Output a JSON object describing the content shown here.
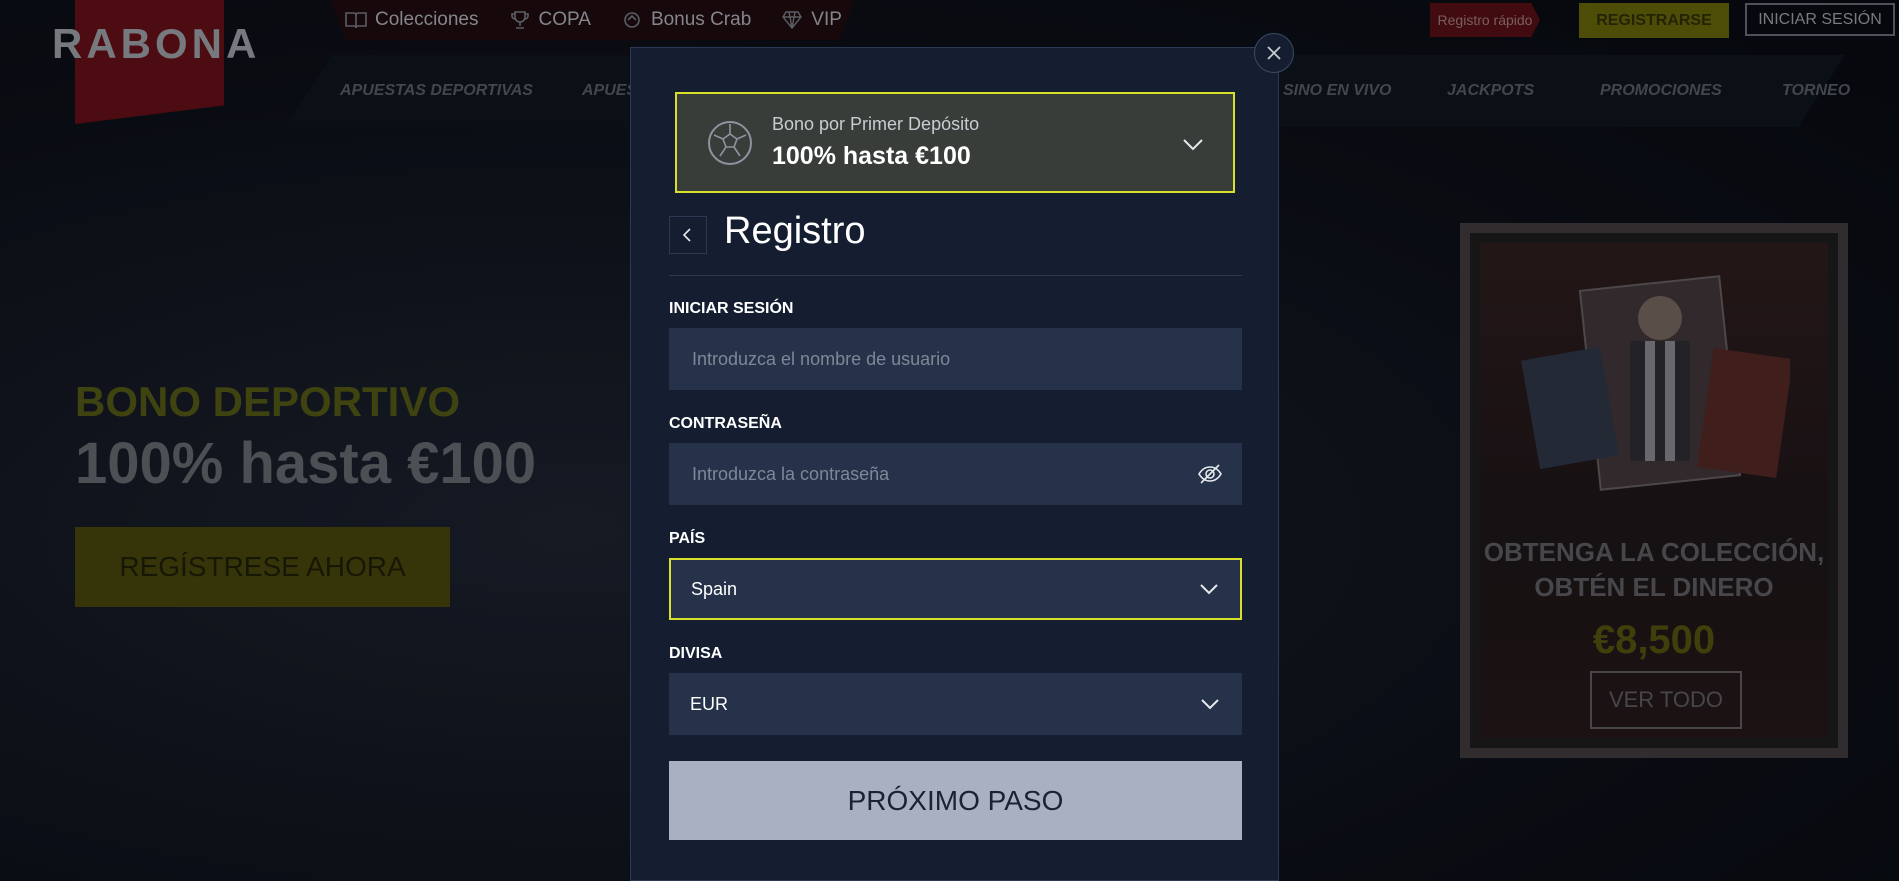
{
  "header": {
    "logo": "RABONA",
    "topnav": [
      {
        "label": "Colecciones",
        "icon": "book-icon"
      },
      {
        "label": "COPA",
        "icon": "trophy-icon"
      },
      {
        "label": "Bonus Crab",
        "icon": "crab-icon"
      },
      {
        "label": "VIP",
        "icon": "diamond-icon"
      }
    ],
    "register_fast": "Registro rápido",
    "register_button": "REGISTRARSE",
    "login_button": "INICIAR SESIÓN",
    "mainnav": [
      "APUESTAS DEPORTIVAS",
      "APUES",
      "SINO EN VIVO",
      "JACKPOTS",
      "PROMOCIONES",
      "TORNEO"
    ]
  },
  "hero": {
    "subtitle": "BONO DEPORTIVO",
    "title": "100% hasta €100",
    "button": "REGÍSTRESE AHORA"
  },
  "promo": {
    "title_line1": "OBTENGA LA COLECCIÓN,",
    "title_line2": "OBTÉN EL DINERO",
    "amount": "€8,500",
    "button": "VER TODO"
  },
  "modal": {
    "bonus_label": "Bono por Primer Depósito",
    "bonus_value": "100% hasta €100",
    "title": "Registro",
    "login_label": "INICIAR SESIÓN",
    "login_placeholder": "Introduzca el nombre de usuario",
    "password_label": "CONTRASEÑA",
    "password_placeholder": "Introduzca la contraseña",
    "country_label": "PAÍS",
    "country_value": "Spain",
    "currency_label": "DIVISA",
    "currency_value": "EUR",
    "next_button": "PRÓXIMO PASO"
  },
  "colors": {
    "accent": "#d9e02c",
    "modal_bg": "#141e30",
    "field_bg": "#26324a",
    "next_btn": "#a8b0c2"
  }
}
